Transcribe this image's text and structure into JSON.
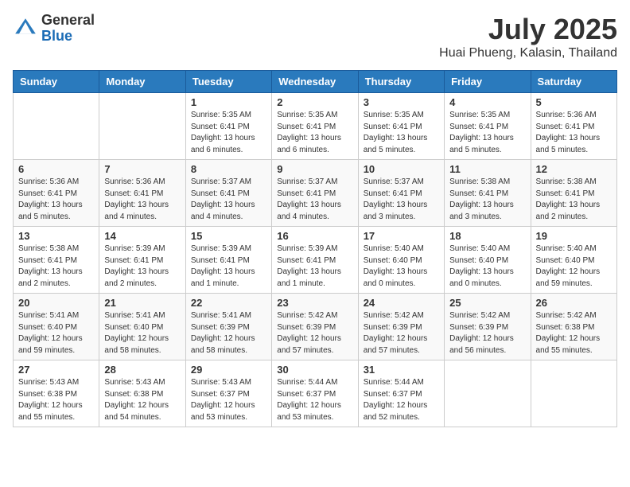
{
  "header": {
    "logo_general": "General",
    "logo_blue": "Blue",
    "title": "July 2025",
    "subtitle": "Huai Phueng, Kalasin, Thailand"
  },
  "days_of_week": [
    "Sunday",
    "Monday",
    "Tuesday",
    "Wednesday",
    "Thursday",
    "Friday",
    "Saturday"
  ],
  "weeks": [
    [
      {
        "day": "",
        "info": ""
      },
      {
        "day": "",
        "info": ""
      },
      {
        "day": "1",
        "info": "Sunrise: 5:35 AM\nSunset: 6:41 PM\nDaylight: 13 hours and 6 minutes."
      },
      {
        "day": "2",
        "info": "Sunrise: 5:35 AM\nSunset: 6:41 PM\nDaylight: 13 hours and 6 minutes."
      },
      {
        "day": "3",
        "info": "Sunrise: 5:35 AM\nSunset: 6:41 PM\nDaylight: 13 hours and 5 minutes."
      },
      {
        "day": "4",
        "info": "Sunrise: 5:35 AM\nSunset: 6:41 PM\nDaylight: 13 hours and 5 minutes."
      },
      {
        "day": "5",
        "info": "Sunrise: 5:36 AM\nSunset: 6:41 PM\nDaylight: 13 hours and 5 minutes."
      }
    ],
    [
      {
        "day": "6",
        "info": "Sunrise: 5:36 AM\nSunset: 6:41 PM\nDaylight: 13 hours and 5 minutes."
      },
      {
        "day": "7",
        "info": "Sunrise: 5:36 AM\nSunset: 6:41 PM\nDaylight: 13 hours and 4 minutes."
      },
      {
        "day": "8",
        "info": "Sunrise: 5:37 AM\nSunset: 6:41 PM\nDaylight: 13 hours and 4 minutes."
      },
      {
        "day": "9",
        "info": "Sunrise: 5:37 AM\nSunset: 6:41 PM\nDaylight: 13 hours and 4 minutes."
      },
      {
        "day": "10",
        "info": "Sunrise: 5:37 AM\nSunset: 6:41 PM\nDaylight: 13 hours and 3 minutes."
      },
      {
        "day": "11",
        "info": "Sunrise: 5:38 AM\nSunset: 6:41 PM\nDaylight: 13 hours and 3 minutes."
      },
      {
        "day": "12",
        "info": "Sunrise: 5:38 AM\nSunset: 6:41 PM\nDaylight: 13 hours and 2 minutes."
      }
    ],
    [
      {
        "day": "13",
        "info": "Sunrise: 5:38 AM\nSunset: 6:41 PM\nDaylight: 13 hours and 2 minutes."
      },
      {
        "day": "14",
        "info": "Sunrise: 5:39 AM\nSunset: 6:41 PM\nDaylight: 13 hours and 2 minutes."
      },
      {
        "day": "15",
        "info": "Sunrise: 5:39 AM\nSunset: 6:41 PM\nDaylight: 13 hours and 1 minute."
      },
      {
        "day": "16",
        "info": "Sunrise: 5:39 AM\nSunset: 6:41 PM\nDaylight: 13 hours and 1 minute."
      },
      {
        "day": "17",
        "info": "Sunrise: 5:40 AM\nSunset: 6:40 PM\nDaylight: 13 hours and 0 minutes."
      },
      {
        "day": "18",
        "info": "Sunrise: 5:40 AM\nSunset: 6:40 PM\nDaylight: 13 hours and 0 minutes."
      },
      {
        "day": "19",
        "info": "Sunrise: 5:40 AM\nSunset: 6:40 PM\nDaylight: 12 hours and 59 minutes."
      }
    ],
    [
      {
        "day": "20",
        "info": "Sunrise: 5:41 AM\nSunset: 6:40 PM\nDaylight: 12 hours and 59 minutes."
      },
      {
        "day": "21",
        "info": "Sunrise: 5:41 AM\nSunset: 6:40 PM\nDaylight: 12 hours and 58 minutes."
      },
      {
        "day": "22",
        "info": "Sunrise: 5:41 AM\nSunset: 6:39 PM\nDaylight: 12 hours and 58 minutes."
      },
      {
        "day": "23",
        "info": "Sunrise: 5:42 AM\nSunset: 6:39 PM\nDaylight: 12 hours and 57 minutes."
      },
      {
        "day": "24",
        "info": "Sunrise: 5:42 AM\nSunset: 6:39 PM\nDaylight: 12 hours and 57 minutes."
      },
      {
        "day": "25",
        "info": "Sunrise: 5:42 AM\nSunset: 6:39 PM\nDaylight: 12 hours and 56 minutes."
      },
      {
        "day": "26",
        "info": "Sunrise: 5:42 AM\nSunset: 6:38 PM\nDaylight: 12 hours and 55 minutes."
      }
    ],
    [
      {
        "day": "27",
        "info": "Sunrise: 5:43 AM\nSunset: 6:38 PM\nDaylight: 12 hours and 55 minutes."
      },
      {
        "day": "28",
        "info": "Sunrise: 5:43 AM\nSunset: 6:38 PM\nDaylight: 12 hours and 54 minutes."
      },
      {
        "day": "29",
        "info": "Sunrise: 5:43 AM\nSunset: 6:37 PM\nDaylight: 12 hours and 53 minutes."
      },
      {
        "day": "30",
        "info": "Sunrise: 5:44 AM\nSunset: 6:37 PM\nDaylight: 12 hours and 53 minutes."
      },
      {
        "day": "31",
        "info": "Sunrise: 5:44 AM\nSunset: 6:37 PM\nDaylight: 12 hours and 52 minutes."
      },
      {
        "day": "",
        "info": ""
      },
      {
        "day": "",
        "info": ""
      }
    ]
  ]
}
